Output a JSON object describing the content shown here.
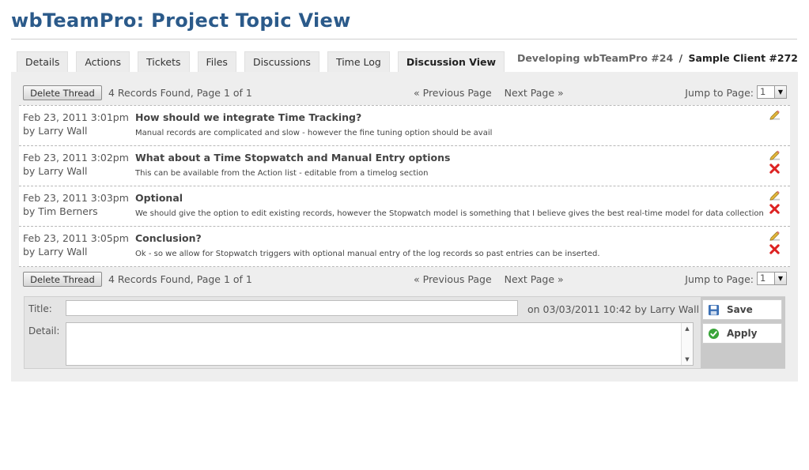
{
  "page": {
    "title": "wbTeamPro: Project Topic View"
  },
  "tabs": [
    {
      "label": "Details"
    },
    {
      "label": "Actions"
    },
    {
      "label": "Tickets"
    },
    {
      "label": "Files"
    },
    {
      "label": "Discussions"
    },
    {
      "label": "Time Log"
    },
    {
      "label": "Discussion View",
      "active": true
    }
  ],
  "context": {
    "project": "Developing wbTeamPro #24",
    "separator": "/",
    "client": "Sample Client #272"
  },
  "toolbar": {
    "delete_label": "Delete Thread",
    "records_text": "4 Records Found, Page 1 of 1",
    "prev_label": "« Previous Page",
    "next_label": "Next Page »",
    "jump_label": "Jump to Page:",
    "page_value": "1"
  },
  "threads": [
    {
      "date": "Feb 23, 2011 3:01pm",
      "author": "by Larry Wall",
      "topic": "How should we integrate Time Tracking?",
      "detail": "Manual records are complicated and slow - however the fine tuning option should be avail",
      "deletable": false
    },
    {
      "date": "Feb 23, 2011 3:02pm",
      "author": "by Larry Wall",
      "topic": "What about a Time Stopwatch and Manual Entry options",
      "detail": "This can be available from the Action list - editable from a timelog section",
      "deletable": true
    },
    {
      "date": "Feb 23, 2011 3:03pm",
      "author": "by Tim Berners",
      "topic": "Optional",
      "detail": "We should give the option to edit existing records, however the Stopwatch model is something that I believe gives the best real-time model for data collection",
      "deletable": true
    },
    {
      "date": "Feb 23, 2011 3:05pm",
      "author": "by Larry Wall",
      "topic": "Conclusion?",
      "detail": "Ok - so we allow for Stopwatch triggers with optional manual entry of the log records so past entries can be inserted.",
      "deletable": true
    }
  ],
  "form": {
    "title_label": "Title:",
    "detail_label": "Detail:",
    "title_value": "",
    "detail_value": "",
    "meta_text": "on 03/03/2011 10:42 by Larry Wall",
    "save_label": "Save",
    "apply_label": "Apply"
  },
  "colors": {
    "title": "#2b5a8a",
    "delete_icon": "#dd2222",
    "edit_icon": "#e3b53a",
    "apply_icon": "#3aa53a",
    "save_icon": "#3a6fb5"
  }
}
